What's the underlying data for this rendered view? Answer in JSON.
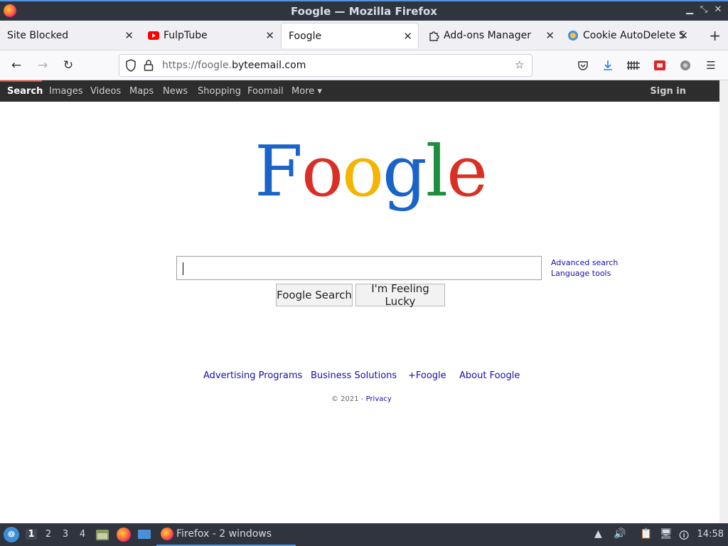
{
  "window": {
    "title": "Foogle — Mozilla Firefox"
  },
  "tabs": [
    {
      "label": "Site Blocked",
      "icon": "none"
    },
    {
      "label": "FulpTube",
      "icon": "youtube-icon"
    },
    {
      "label": "Foogle",
      "icon": "none",
      "active": true
    },
    {
      "label": "Add-ons Manager",
      "icon": "puzzle-icon"
    },
    {
      "label": "Cookie AutoDelete S",
      "icon": "cookie-icon"
    }
  ],
  "nav": {
    "url_scheme": "https://foogle.",
    "url_domain": "byteemail.com"
  },
  "gbar": {
    "items": [
      "Search",
      "Images",
      "Videos",
      "Maps",
      "News",
      "Shopping",
      "Foomail",
      "More ▾"
    ],
    "signin": "Sign in"
  },
  "logo": {
    "letters": [
      "F",
      "o",
      "o",
      "g",
      "l",
      "e"
    ],
    "colors": [
      "#1a63c9",
      "#d93025",
      "#f4b400",
      "#1a63c9",
      "#1e8e3e",
      "#d93025"
    ]
  },
  "search": {
    "value": "",
    "advanced": "Advanced search",
    "language": "Language tools",
    "search_button": "Foogle Search",
    "lucky_button": "I'm Feeling Lucky"
  },
  "footer": {
    "links": [
      "Advertising Programs",
      "Business Solutions",
      "+Foogle",
      "About Foogle"
    ],
    "copyright": "© 2021 - ",
    "privacy": "Privacy"
  },
  "taskbar": {
    "workspaces": [
      "1",
      "2",
      "3",
      "4"
    ],
    "active_workspace": "1",
    "task_label": "Firefox - 2 windows",
    "clock": "14:58"
  }
}
